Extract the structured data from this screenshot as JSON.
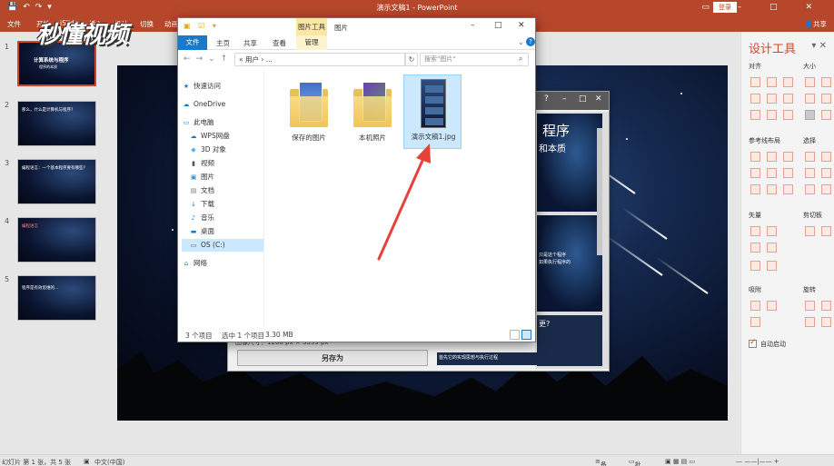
{
  "app": {
    "title": "演示文稿1 - PowerPoint",
    "login": "登录",
    "share": "共享"
  },
  "ribbon_tabs": [
    "文件",
    "开始",
    "iSlide",
    "插入",
    "设计",
    "切换",
    "动画"
  ],
  "slides": [
    {
      "num": "1",
      "text": "计算系统与程序"
    },
    {
      "num": "2",
      "text": "那么，什么是计算机与程序?"
    },
    {
      "num": "3",
      "text": "编程语言：一个基本程序要有哪些?"
    },
    {
      "num": "4",
      "text": "编程语言"
    },
    {
      "num": "5",
      "text": "程序是有效思维的..."
    }
  ],
  "slide1_subtitle": "程序的本质",
  "right_panel": {
    "title": "设计工具",
    "sections": [
      "对齐",
      "大小",
      "参考线布局",
      "选择",
      "矢量",
      "剪切板",
      "吸附",
      "旋转"
    ],
    "auto_start": "自动启动"
  },
  "statusbar": {
    "slide_info": "幻灯片 第 1 张，共 5 张",
    "language": "中文(中国)",
    "notes": "备注",
    "comments": "批注"
  },
  "dialog2": {
    "dimensions": "图像尺寸：1268 px × 3399 px",
    "save_as": "另存为",
    "preview_texts": [
      "程序",
      "和本质",
      "只是这个程序",
      "如果执行程序的",
      "更?",
      "首先它的实现思想与执行过程"
    ]
  },
  "explorer": {
    "context_group": "图片工具",
    "title": "图片",
    "tabs": {
      "file": "文件",
      "home": "主页",
      "share": "共享",
      "view": "查看",
      "manage": "管理"
    },
    "address": "« 用户 › ...",
    "search_placeholder": "搜索\"图片\"",
    "nav": [
      {
        "icon": "star-icon",
        "label": "快速访问"
      },
      {
        "icon": "cloud-icon",
        "label": "OneDrive"
      },
      {
        "icon": "computer-icon",
        "label": "此电脑"
      },
      {
        "icon": "cloud-disk-icon",
        "label": "WPS网盘"
      },
      {
        "icon": "cube-icon",
        "label": "3D 对象"
      },
      {
        "icon": "video-icon",
        "label": "视频"
      },
      {
        "icon": "image-icon",
        "label": "图片"
      },
      {
        "icon": "document-icon",
        "label": "文档"
      },
      {
        "icon": "download-icon",
        "label": "下载"
      },
      {
        "icon": "music-icon",
        "label": "音乐"
      },
      {
        "icon": "desktop-icon",
        "label": "桌面"
      },
      {
        "icon": "drive-icon",
        "label": "OS (C:)"
      },
      {
        "icon": "network-icon",
        "label": "网络"
      }
    ],
    "items": [
      {
        "label": "保存的图片",
        "type": "folder",
        "colors": [
          "#3f6fc9",
          "#8fb6ef"
        ]
      },
      {
        "label": "本机照片",
        "type": "folder",
        "colors": [
          "#6a3fb0",
          "#5fa46a"
        ]
      },
      {
        "label": "演示文稿1.jpg",
        "type": "jpg"
      }
    ],
    "status": {
      "count": "3 个项目",
      "selected": "选中 1 个项目",
      "size": "3.30 MB"
    }
  },
  "watermark": "秒懂视频",
  "colors": {
    "accent": "#b7472a",
    "select": "#cce8ff",
    "arrow": "#e8403a"
  }
}
